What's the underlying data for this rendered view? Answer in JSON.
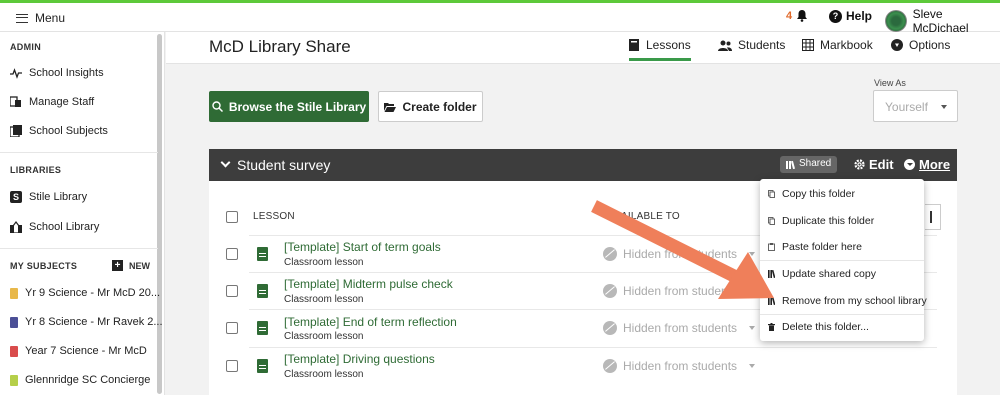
{
  "topbar": {
    "menu_label": "Menu",
    "notification_count": "4",
    "help_label": "Help",
    "user_name": "Sleve McDichael"
  },
  "sidebar": {
    "admin_heading": "ADMIN",
    "admin_items": [
      {
        "label": "School Insights",
        "icon": "pulse-icon"
      },
      {
        "label": "Manage Staff",
        "icon": "staff-icon"
      },
      {
        "label": "School Subjects",
        "icon": "book-stack-icon"
      }
    ],
    "libraries_heading": "LIBRARIES",
    "library_items": [
      {
        "label": "Stile Library",
        "icon": "stile-s-icon"
      },
      {
        "label": "School Library",
        "icon": "school-building-icon"
      }
    ],
    "subjects_heading": "MY SUBJECTS",
    "new_label": "NEW",
    "subjects": [
      {
        "label": "Yr 9 Science - Mr McD 20...",
        "color": "#e8b84a"
      },
      {
        "label": "Yr 8 Science - Mr Ravek 2...",
        "color": "#4b4f96"
      },
      {
        "label": "Year 7 Science - Mr McD",
        "color": "#d94c4c"
      },
      {
        "label": "Glennridge SC Concierge",
        "color": "#b5cf4a"
      }
    ]
  },
  "header": {
    "title": "McD Library Share",
    "tabs": [
      {
        "label": "Lessons",
        "icon": "book-icon",
        "active": true
      },
      {
        "label": "Students",
        "icon": "people-icon",
        "active": false
      },
      {
        "label": "Markbook",
        "icon": "grid-icon",
        "active": false
      },
      {
        "label": "Options",
        "icon": "gear-icon",
        "active": false
      }
    ]
  },
  "toolbar": {
    "browse_label": "Browse the Stile Library",
    "create_folder_label": "Create folder",
    "view_as_label": "View As",
    "view_as_value": "Yourself"
  },
  "folder": {
    "title": "Student survey",
    "shared_label": "Shared",
    "edit_label": "Edit",
    "more_label": "More",
    "col_lesson": "LESSON",
    "col_available": "AILABLE TO",
    "lessons": [
      {
        "title": "[Template] Start of term goals",
        "type": "Classroom lesson",
        "availability": "Hidden from students"
      },
      {
        "title": "[Template] Midterm pulse check",
        "type": "Classroom lesson",
        "availability": "Hidden from studen"
      },
      {
        "title": "[Template] End of term reflection",
        "type": "Classroom lesson",
        "availability": "Hidden from students"
      },
      {
        "title": "[Template] Driving questions",
        "type": "Classroom lesson",
        "availability": "Hidden from students"
      }
    ]
  },
  "more_menu": {
    "items": [
      {
        "label": "Copy this folder",
        "icon": "copy-icon"
      },
      {
        "label": "Duplicate this folder",
        "icon": "duplicate-icon"
      },
      {
        "label": "Paste folder here",
        "icon": "paste-icon"
      },
      {
        "label": "Update shared copy",
        "icon": "library-icon"
      },
      {
        "label": "Remove from my school library",
        "icon": "library-icon"
      },
      {
        "label": "Delete this folder...",
        "icon": "trash-icon"
      }
    ]
  },
  "colors": {
    "brand_green": "#2f6b35",
    "accent_green": "#5dc93a",
    "annotation_arrow": "#ef7f5a"
  }
}
